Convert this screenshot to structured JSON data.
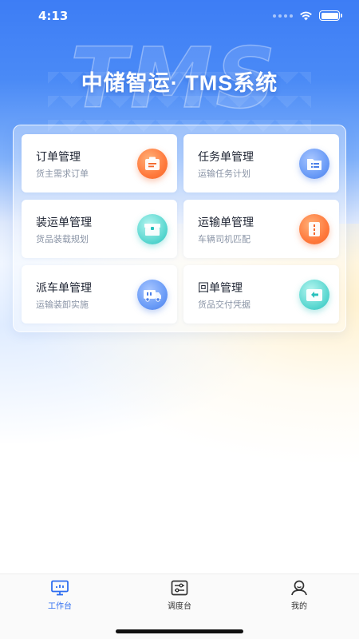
{
  "status_bar": {
    "time": "4:13"
  },
  "header": {
    "title": "中储智运· TMS系统",
    "watermark": "TMS"
  },
  "colors": {
    "primary": "#3d7df5",
    "tab_active": "#2f6ef0",
    "tab_inactive": "#333333"
  },
  "cards": [
    {
      "title": "订单管理",
      "subtitle": "货主需求订单",
      "icon": "clipboard-icon",
      "color": "orange"
    },
    {
      "title": "任务单管理",
      "subtitle": "运输任务计划",
      "icon": "folder-list-icon",
      "color": "blue"
    },
    {
      "title": "装运单管理",
      "subtitle": "货品装载规划",
      "icon": "box-icon",
      "color": "cyan"
    },
    {
      "title": "运输单管理",
      "subtitle": "车辆司机匹配",
      "icon": "document-icon",
      "color": "orange"
    },
    {
      "title": "派车单管理",
      "subtitle": "运输装卸实施",
      "icon": "truck-icon",
      "color": "blue"
    },
    {
      "title": "回单管理",
      "subtitle": "货品交付凭据",
      "icon": "return-receipt-icon",
      "color": "cyan"
    }
  ],
  "tab_bar": {
    "items": [
      {
        "label": "工作台",
        "icon": "monitor-icon",
        "active": true
      },
      {
        "label": "调度台",
        "icon": "dispatch-icon",
        "active": false
      },
      {
        "label": "我的",
        "icon": "user-icon",
        "active": false
      }
    ]
  }
}
